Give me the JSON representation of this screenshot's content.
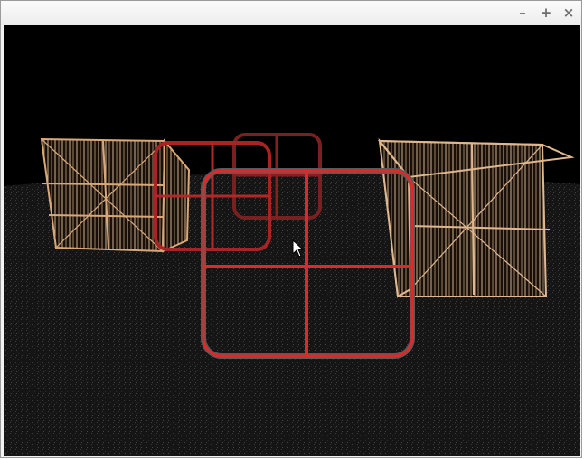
{
  "window": {
    "title": "",
    "controls": {
      "minimize": "–",
      "maximize": "+",
      "close": "×"
    }
  },
  "scene": {
    "description_icons": [
      "crate-left",
      "crate-right",
      "glass-pane-front",
      "glass-pane-mid",
      "glass-pane-back",
      "floor-plane"
    ],
    "colors": {
      "background": "#000000",
      "floor": "#1a1a1a",
      "crate_edge_left": "#d8a878",
      "crate_edge_right": "#e0b890",
      "pane_red": "#e12828",
      "pane_dark": "#8a1e1e"
    }
  }
}
